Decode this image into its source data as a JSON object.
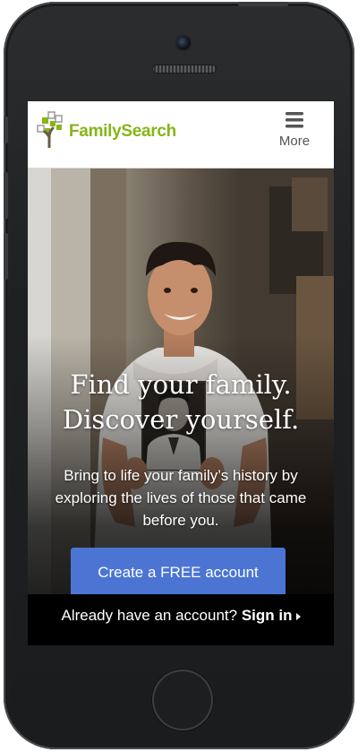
{
  "header": {
    "logo_text": "FamilySearch",
    "menu_label": "More"
  },
  "hero": {
    "headline_line1": "Find your family.",
    "headline_line2": "Discover yourself.",
    "subtext": "Bring to life your family’s history by exploring the lives of those that came before you.",
    "cta_label": "Create a FREE account"
  },
  "signin": {
    "prompt": "Already have an account?",
    "link_label": "Sign in"
  },
  "colors": {
    "brand_green": "#86b518",
    "cta_blue": "#4b74d3"
  },
  "icons": {
    "menu": "hamburger-icon",
    "logo": "family-tree-logo-icon",
    "signin_arrow": "caret-right-icon"
  }
}
